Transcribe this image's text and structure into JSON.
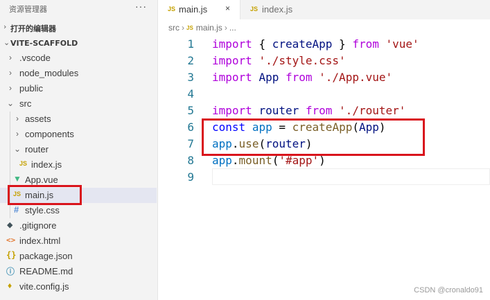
{
  "explorer": {
    "title": "资源管理器",
    "more": "···",
    "open_editors": "打开的编辑器",
    "project": "VITE-SCAFFOLD",
    "items": [
      {
        "name": ".vscode",
        "kind": "folder",
        "expanded": false
      },
      {
        "name": "node_modules",
        "kind": "folder",
        "expanded": false
      },
      {
        "name": "public",
        "kind": "folder",
        "expanded": false
      },
      {
        "name": "src",
        "kind": "folder",
        "expanded": true
      },
      {
        "name": "assets",
        "kind": "folder",
        "expanded": false
      },
      {
        "name": "components",
        "kind": "folder",
        "expanded": false
      },
      {
        "name": "router",
        "kind": "folder",
        "expanded": true
      },
      {
        "name": "index.js",
        "kind": "js",
        "icon": "JS"
      },
      {
        "name": "App.vue",
        "kind": "vue",
        "icon": "vue-icon"
      },
      {
        "name": "main.js",
        "kind": "js",
        "icon": "JS",
        "selected": true
      },
      {
        "name": "style.css",
        "kind": "css",
        "icon": "#"
      },
      {
        "name": ".gitignore",
        "kind": "git",
        "icon": "git-icon"
      },
      {
        "name": "index.html",
        "kind": "html",
        "icon": "<>"
      },
      {
        "name": "package.json",
        "kind": "json",
        "icon": "{}"
      },
      {
        "name": "README.md",
        "kind": "info",
        "icon": "ⓘ"
      },
      {
        "name": "vite.config.js",
        "kind": "vite",
        "icon": "vite-icon"
      }
    ]
  },
  "tabs": [
    {
      "label": "main.js",
      "icon": "JS",
      "active": true,
      "close": "×"
    },
    {
      "label": "index.js",
      "icon": "JS",
      "active": false
    }
  ],
  "breadcrumb": {
    "folder": "src",
    "file": "main.js",
    "more": "...",
    "file_icon": "JS",
    "sep": "›"
  },
  "editor": {
    "lines": [
      {
        "num": "1"
      },
      {
        "num": "2"
      },
      {
        "num": "3"
      },
      {
        "num": "4"
      },
      {
        "num": "5"
      },
      {
        "num": "6"
      },
      {
        "num": "7"
      },
      {
        "num": "8"
      },
      {
        "num": "9"
      }
    ],
    "tokens": {
      "l1_import": "import",
      "l1_brace_open": "{ ",
      "l1_createApp": "createApp",
      "l1_brace_close": " }",
      "l1_from": "from",
      "l1_source": "'vue'",
      "l2_import": "import",
      "l2_source": "'./style.css'",
      "l3_import": "import",
      "l3_App": "App",
      "l3_from": "from",
      "l3_source": "'./App.vue'",
      "l5_import": "import",
      "l5_router": "router",
      "l5_from": "from",
      "l5_source": "'./router'",
      "l6_const": "const",
      "l6_app": "app",
      "l6_eq": "=",
      "l6_createApp": "createApp",
      "l6_open": "(",
      "l6_App": "App",
      "l6_close": ")",
      "l7_app": "app",
      "l7_dot": ".",
      "l7_use": "use",
      "l7_open": "(",
      "l7_router": "router",
      "l7_close": ")",
      "l8_app": "app",
      "l8_dot": ".",
      "l8_mount": "mount",
      "l8_open": "(",
      "l8_arg": "'#app'",
      "l8_close": ")"
    }
  },
  "colors": {
    "highlight_border": "#d9141c",
    "keyword": "#0000ff",
    "control": "#af00db",
    "string": "#a31515",
    "variable": "#001080",
    "function": "#795e26",
    "line_number": "#237893"
  },
  "watermark": "CSDN @cronaldo91"
}
